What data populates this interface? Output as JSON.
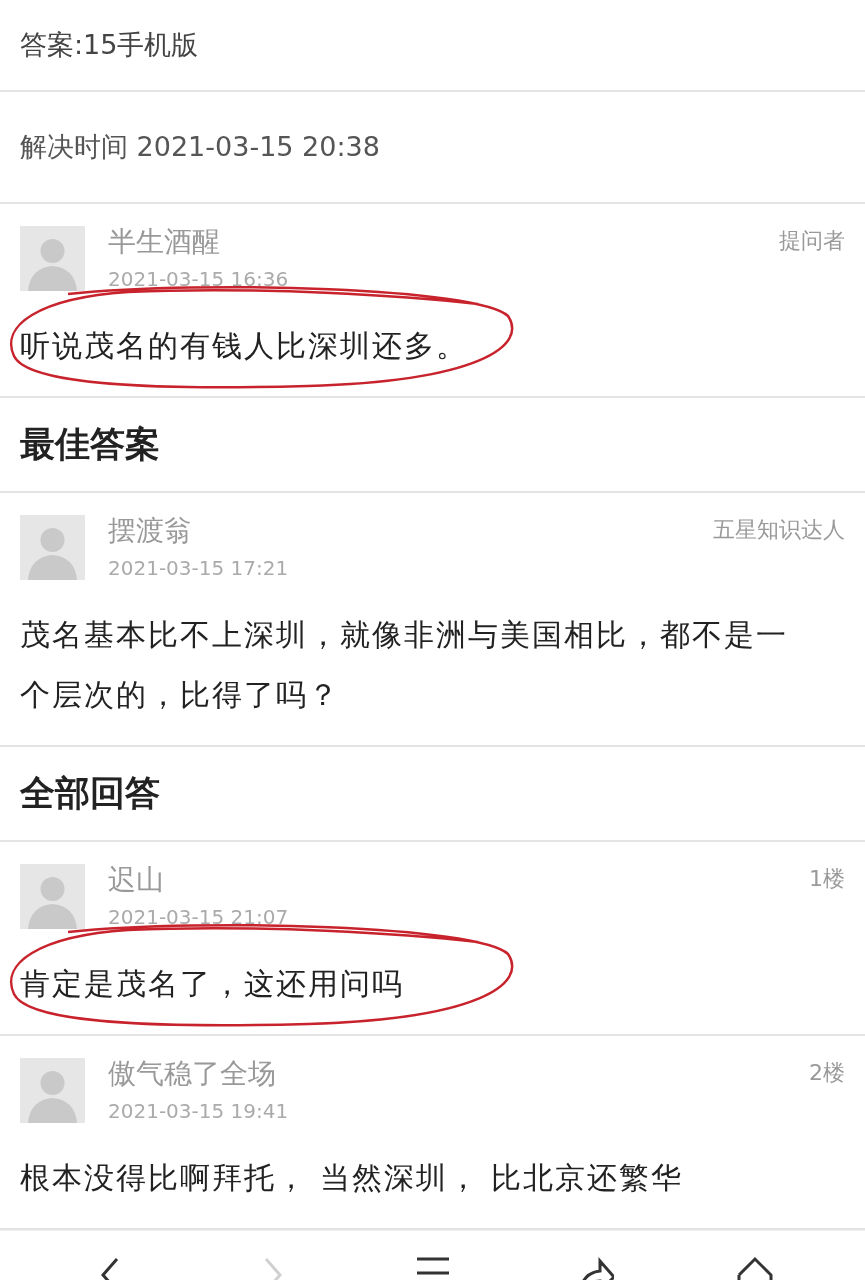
{
  "answer_line": "答案:15手机版",
  "resolved_time": "解决时间 2021-03-15 20:38",
  "question": {
    "author": "半生酒醒",
    "role": "提问者",
    "time": "2021-03-15 16:36",
    "text": "听说茂名的有钱人比深圳还多。",
    "circled": true
  },
  "best_answer": {
    "heading": "最佳答案",
    "author": "摆渡翁",
    "role": "五星知识达人",
    "time": "2021-03-15 17:21",
    "text": "茂名基本比不上深圳，就像非洲与美国相比，都不是一个层次的，比得了吗？",
    "circled": false
  },
  "all_answers": {
    "heading": "全部回答",
    "items": [
      {
        "author": "迟山",
        "floor": "1楼",
        "time": "2021-03-15 21:07",
        "text": "肯定是茂名了，这还用问吗",
        "circled": true
      },
      {
        "author": "傲气稳了全场",
        "floor": "2楼",
        "time": "2021-03-15 19:41",
        "text": "根本没得比啊拜托， 当然深圳， 比北京还繁华",
        "circled": false
      }
    ]
  },
  "bottom_nav": [
    {
      "kind": "back",
      "disabled": false
    },
    {
      "kind": "forward",
      "disabled": true
    },
    {
      "kind": "menu",
      "disabled": false
    },
    {
      "kind": "share",
      "disabled": false
    },
    {
      "kind": "home",
      "disabled": false
    }
  ]
}
